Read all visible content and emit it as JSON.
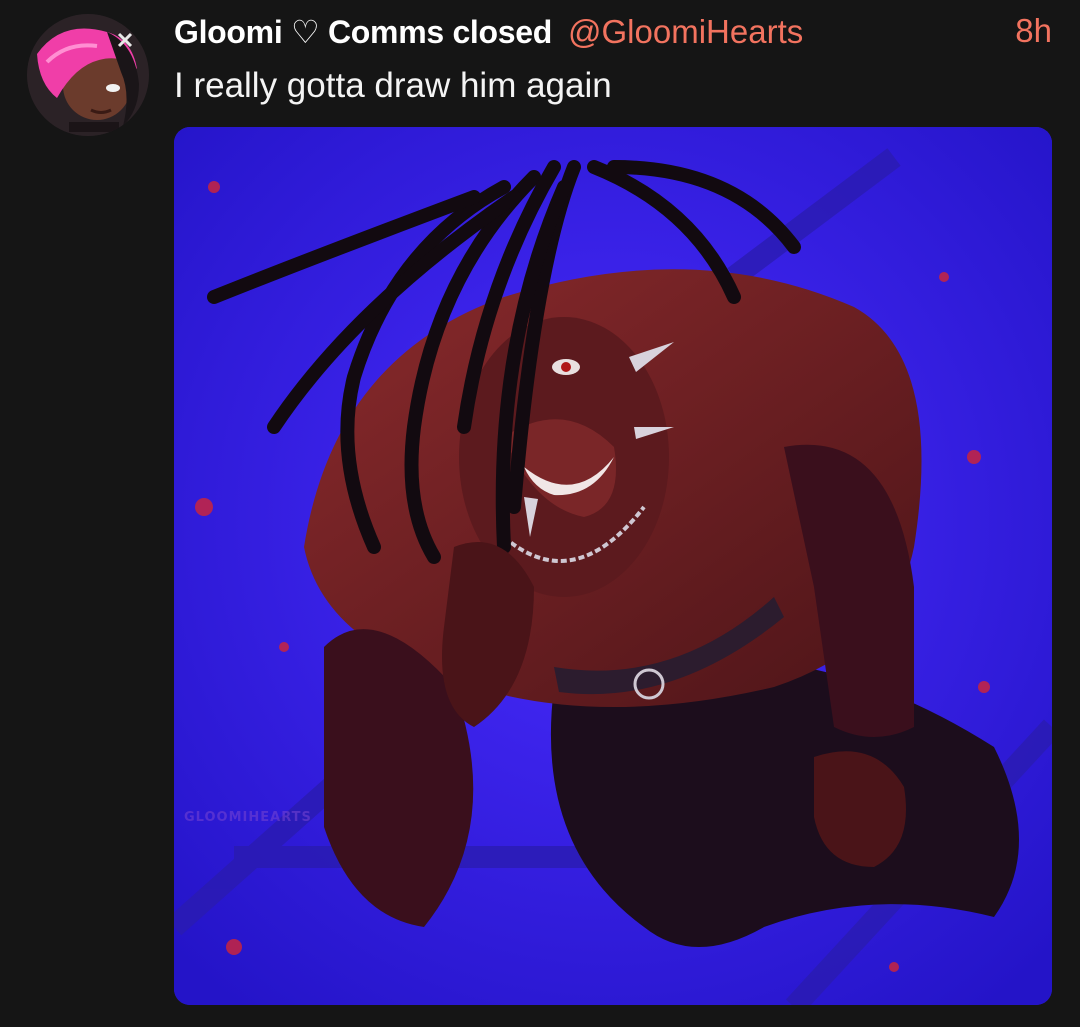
{
  "tweet": {
    "author": {
      "display_name": "Gloomi ♡ Comms closed",
      "handle": "@GloomiHearts",
      "avatar_icon": "avatar-image"
    },
    "timestamp": "8h",
    "text": "I really gotta draw him again",
    "media": {
      "watermark": "GLOOMIHEARTS"
    }
  },
  "colors": {
    "background": "#151515",
    "accent": "#f2735f",
    "text": "#ffffff"
  }
}
